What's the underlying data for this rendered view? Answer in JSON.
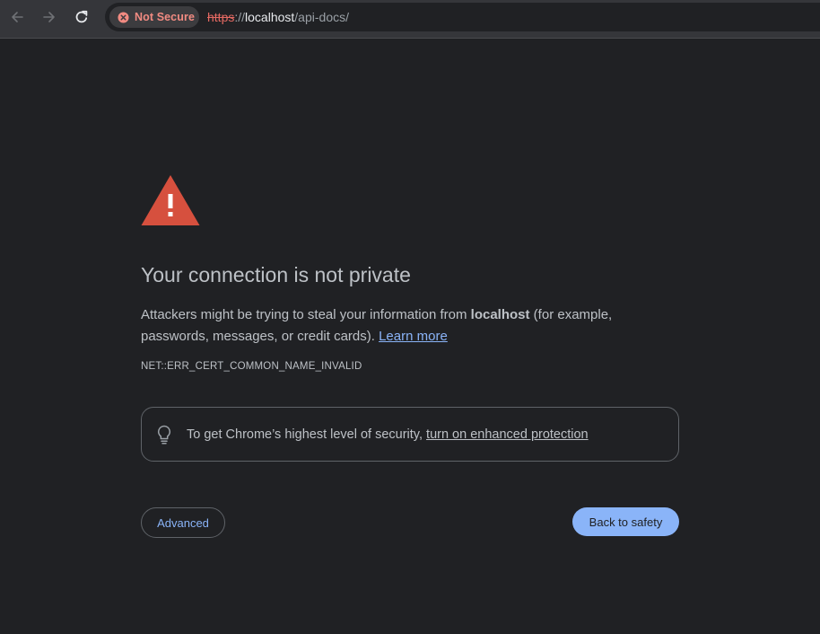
{
  "browser": {
    "security_chip": {
      "label": "Not Secure",
      "icon": "error-circle-icon",
      "color": "#f28b82"
    },
    "url": {
      "scheme": "https",
      "separator": "://",
      "host": "localhost",
      "path": "/api-docs/"
    },
    "nav": {
      "back_icon": "arrow-left-icon",
      "forward_icon": "arrow-right-icon",
      "reload_icon": "reload-icon"
    }
  },
  "interstitial": {
    "icon": "warning-triangle-icon",
    "heading": "Your connection is not private",
    "message_before": "Attackers might be trying to steal your information from ",
    "message_host": "localhost",
    "message_after": " (for example, passwords, messages, or credit cards). ",
    "learn_more": "Learn more",
    "error_code": "NET::ERR_CERT_COMMON_NAME_INVALID",
    "enhanced_icon": "lightbulb-icon",
    "enhanced_prefix": "To get Chrome’s highest level of security, ",
    "enhanced_link": "turn on enhanced protection",
    "advanced_button": "Advanced",
    "back_button": "Back to safety",
    "colors": {
      "accent": "#8ab4f8",
      "warning": "#d6503e",
      "background": "#202124"
    }
  }
}
